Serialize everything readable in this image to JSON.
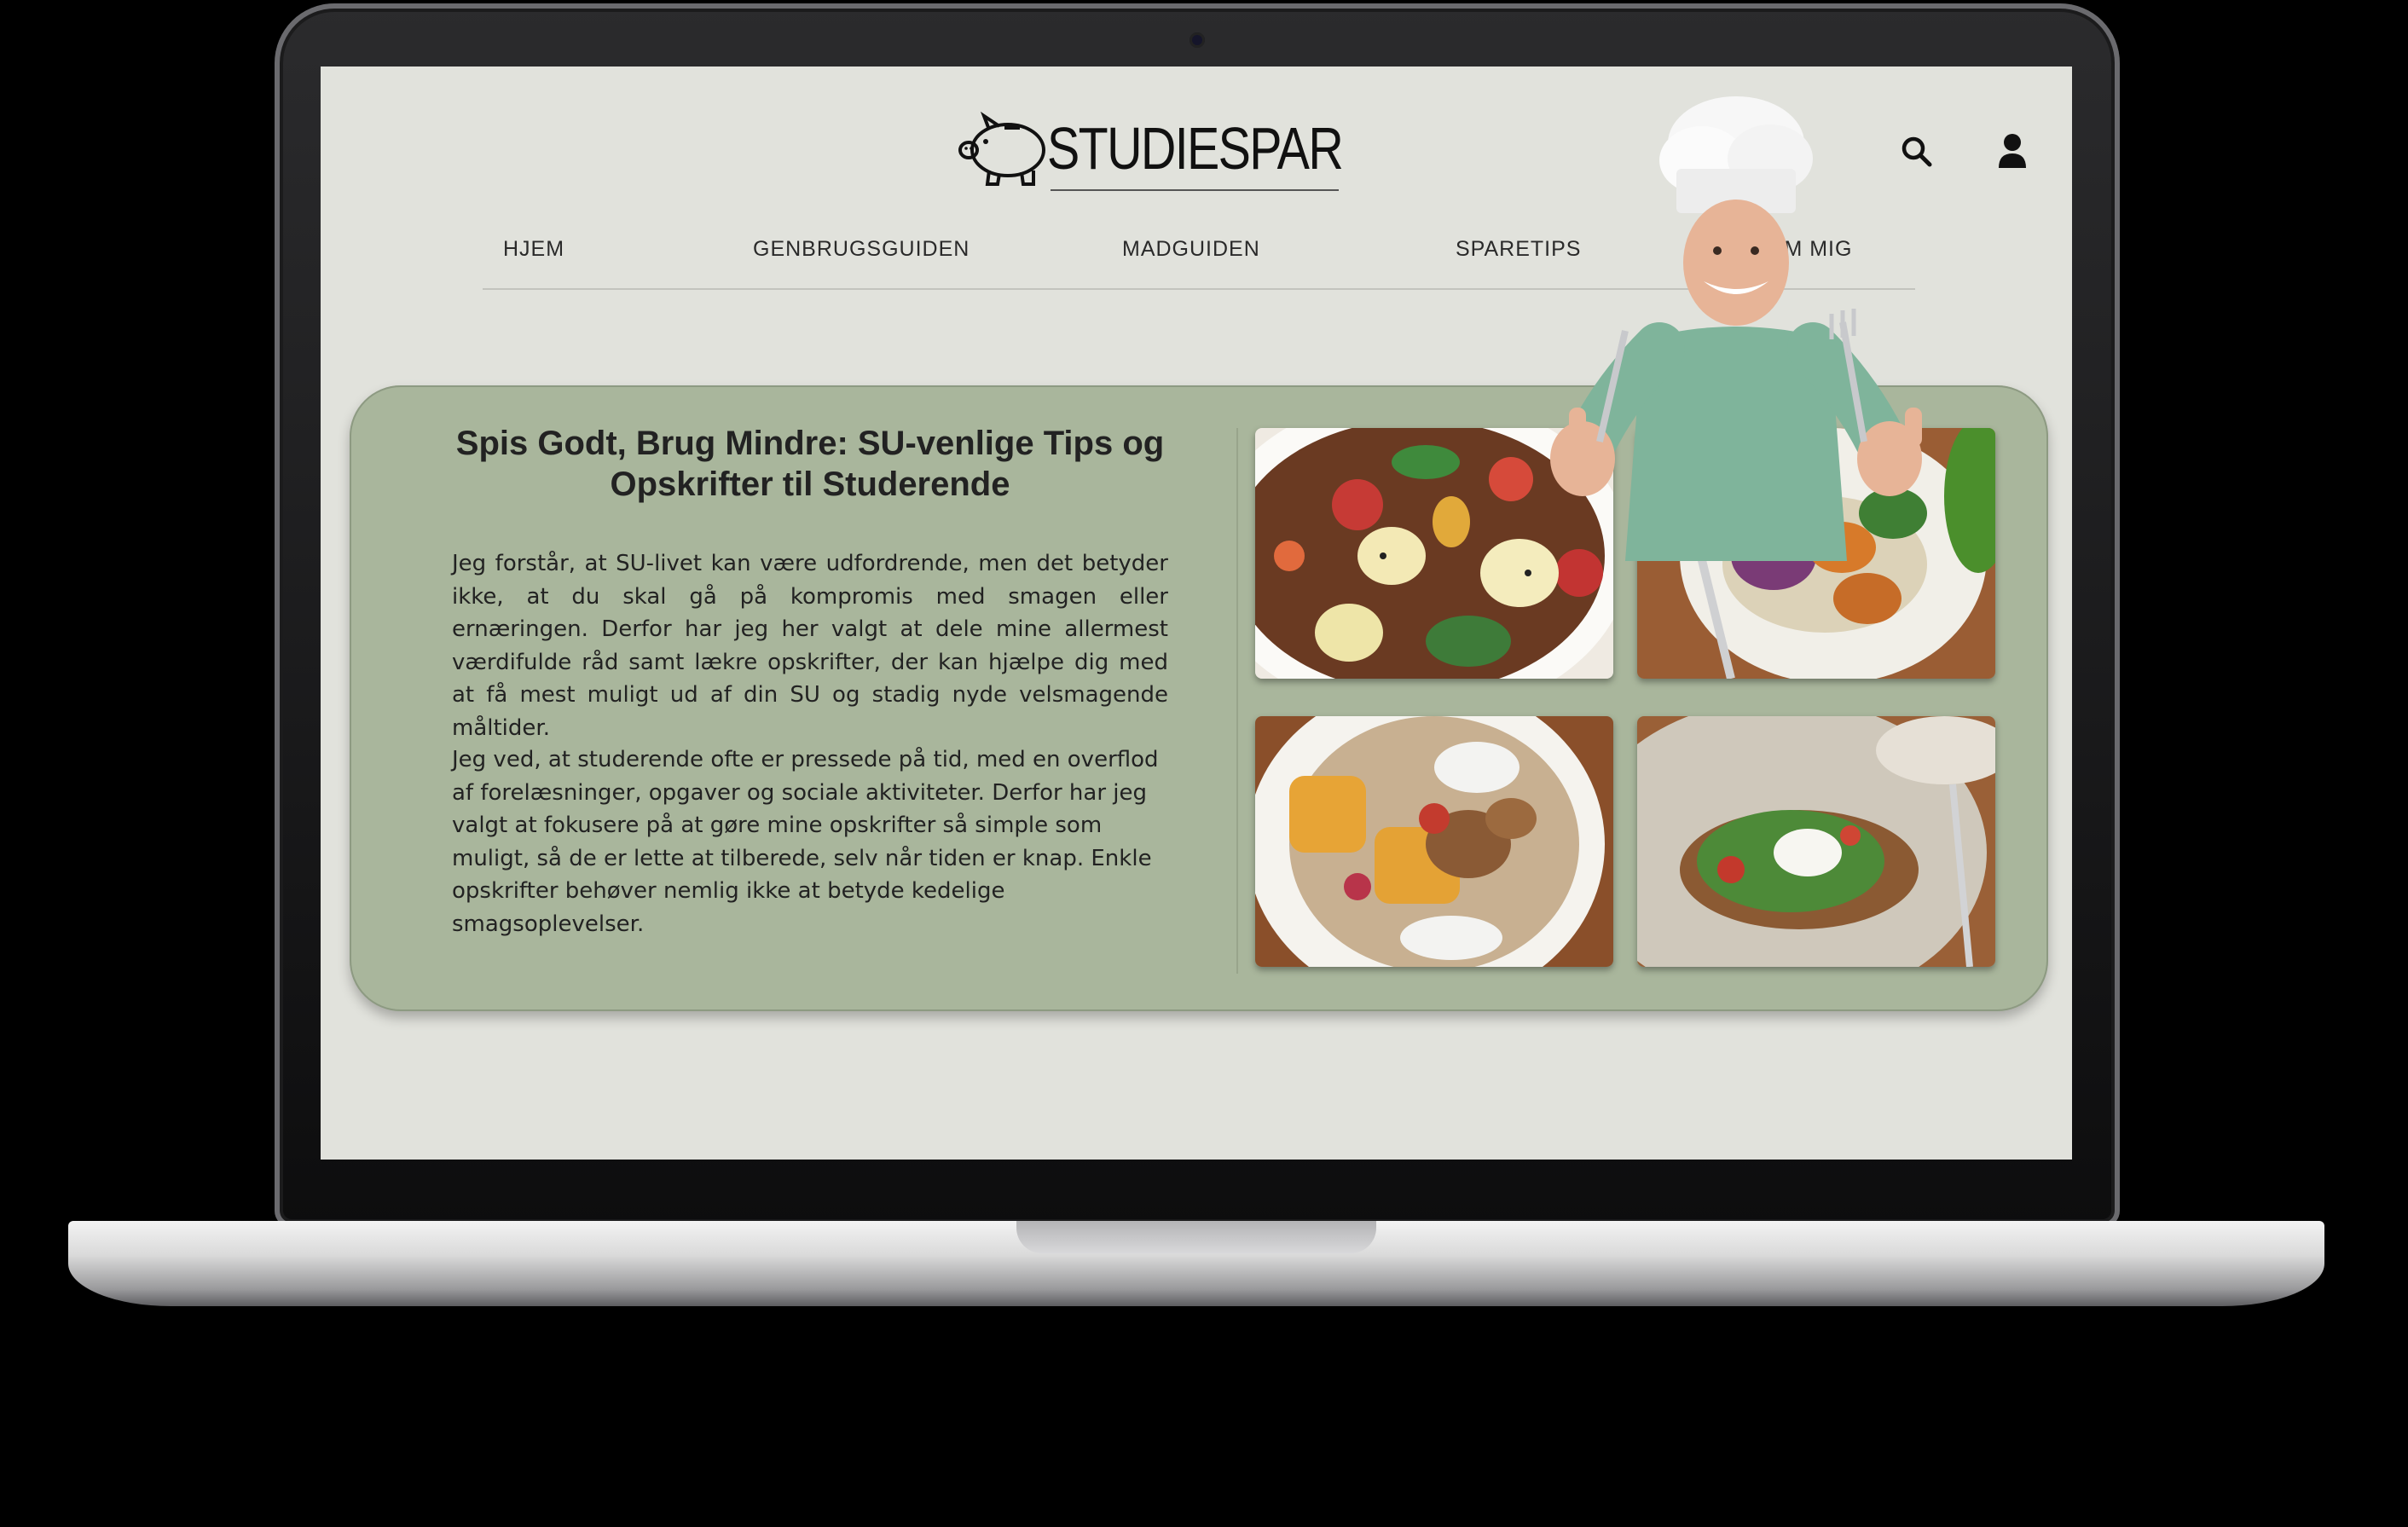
{
  "brand": {
    "logo_text": "STUDIESPAR"
  },
  "nav": {
    "items": [
      {
        "label": "HJEM"
      },
      {
        "label": "GENBRUGSGUIDEN"
      },
      {
        "label": "MADGUIDEN"
      },
      {
        "label": "SPARETIPS"
      },
      {
        "label": "OM MIG"
      }
    ]
  },
  "icons": {
    "search": "search-icon",
    "user": "user-icon"
  },
  "hero": {
    "title": "Spis Godt, Brug Mindre: SU-venlige Tips og Opskrifter til Studerende",
    "paragraph_1": "Jeg forstår, at SU-livet kan være udfordrende, men det betyder ikke, at du skal gå på kompromis med smagen eller ernæringen. Derfor har jeg her valgt at dele mine allermest værdifulde råd samt lækre opskrifter, der kan hjælpe dig med at få mest muligt ud af din SU og stadig nyde velsmagende måltider.",
    "paragraph_2": "Jeg ved, at studerende ofte er pressede på tid, med en overflod af forelæsninger, opgaver og sociale aktiviteter. Derfor har jeg valgt at fokusere på at gøre mine opskrifter så simple som muligt, så de er lette at tilberede, selv når tiden er knap. Enkle opskrifter behøver nemlig ikke at betyde kedelige smagsoplevelser."
  },
  "colors": {
    "page_bg": "#e1e2dc",
    "card_bg": "#a9b69c",
    "text": "#222222"
  }
}
